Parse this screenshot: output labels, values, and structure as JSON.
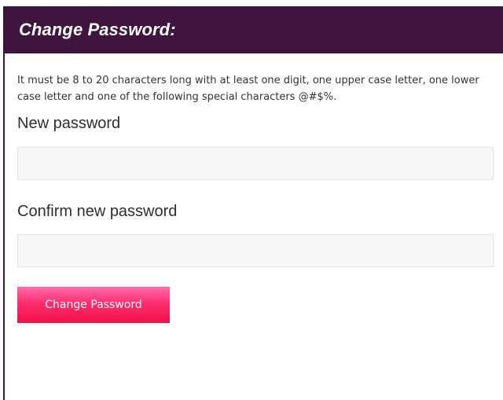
{
  "header": {
    "title": "Change Password:"
  },
  "form": {
    "rules_text": "It must be 8 to 20 characters long with at least one digit, one upper case letter, one lower case letter and one of the following special characters @#$%.",
    "new_password_label": "New password",
    "new_password_value": "",
    "confirm_password_label": "Confirm new password",
    "confirm_password_value": "",
    "submit_label": "Change Password"
  },
  "colors": {
    "header_background": "#3f1540",
    "button_top": "#ff6aa8",
    "button_bottom": "#f01146",
    "field_background": "#f7f7f7"
  }
}
